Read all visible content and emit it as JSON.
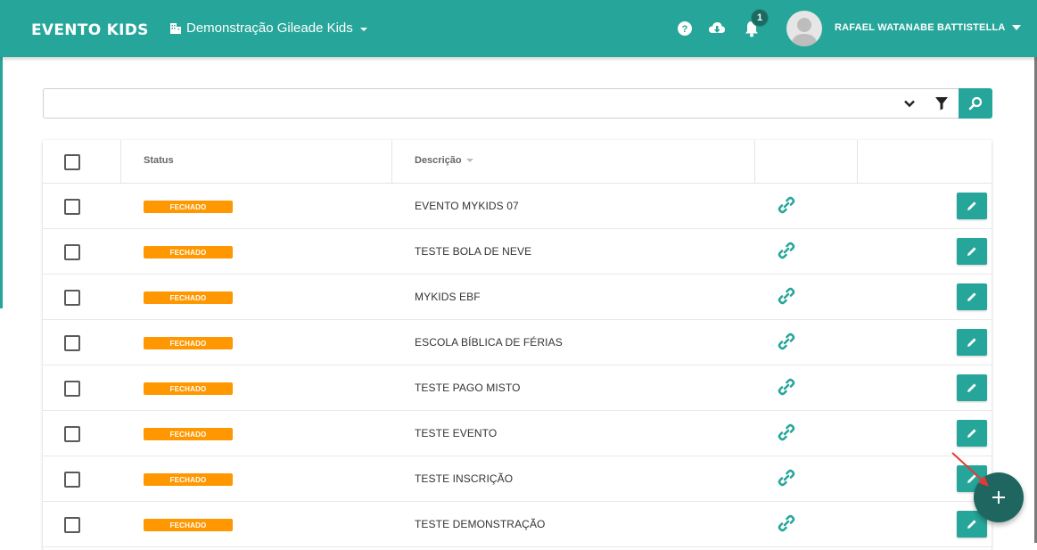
{
  "header": {
    "brand": "EVENTO KIDS",
    "organization": "Demonstração Gileade Kids",
    "notification_count": "1",
    "user_name": "RAFAEL WATANABE BATTISTELLA",
    "icons": [
      "building-icon",
      "help-icon",
      "cloud-download-icon",
      "bell-icon",
      "avatar"
    ]
  },
  "search": {
    "value": "",
    "placeholder": ""
  },
  "table": {
    "columns": [
      "",
      "Status",
      "Descrição",
      "",
      ""
    ],
    "sorted_column": "Descrição",
    "rows": [
      {
        "status": "FECHADO",
        "description": "EVENTO MYKIDS 07"
      },
      {
        "status": "FECHADO",
        "description": "TESTE BOLA DE NEVE"
      },
      {
        "status": "FECHADO",
        "description": "MYKIDS EBF"
      },
      {
        "status": "FECHADO",
        "description": "ESCOLA BÍBLICA DE FÉRIAS"
      },
      {
        "status": "FECHADO",
        "description": "TESTE PAGO MISTO"
      },
      {
        "status": "FECHADO",
        "description": "TESTE EVENTO"
      },
      {
        "status": "FECHADO",
        "description": "TESTE INSCRIÇÃO"
      },
      {
        "status": "FECHADO",
        "description": "TESTE DEMONSTRAÇÃO"
      }
    ]
  },
  "colors": {
    "primary": "#26a69a",
    "fab": "#1e665f",
    "status_closed": "#ff9800",
    "annotation_arrow": "#e53935"
  }
}
